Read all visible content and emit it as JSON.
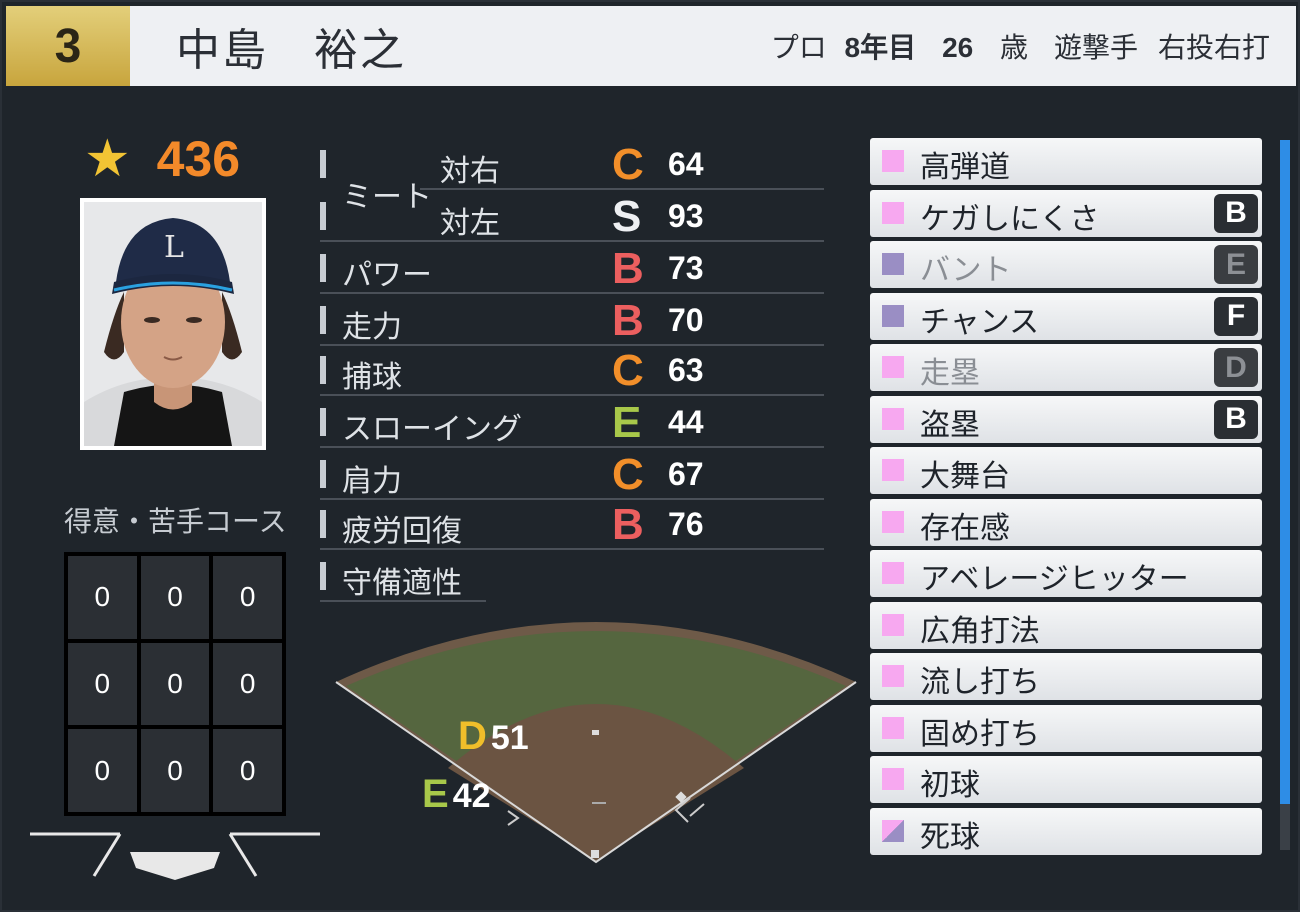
{
  "player": {
    "number": "3",
    "name": "中島　裕之",
    "pro_label": "プロ",
    "years": "8年目",
    "age": "26",
    "age_unit": "歳",
    "position": "遊撃手",
    "handedness": "右投右打",
    "star_icon": "star-icon",
    "power_rating": "436"
  },
  "course": {
    "label": "得意・苦手コース",
    "cells": [
      "0",
      "0",
      "0",
      "0",
      "0",
      "0",
      "0",
      "0",
      "0"
    ]
  },
  "stats": [
    {
      "label": "ミート",
      "sub": "対右",
      "grade": "C",
      "value": "64"
    },
    {
      "label": "",
      "sub": "対左",
      "grade": "S",
      "value": "93"
    },
    {
      "label": "パワー",
      "grade": "B",
      "value": "73"
    },
    {
      "label": "走力",
      "grade": "B",
      "value": "70"
    },
    {
      "label": "捕球",
      "grade": "C",
      "value": "63"
    },
    {
      "label": "スローイング",
      "grade": "E",
      "value": "44"
    },
    {
      "label": "肩力",
      "grade": "C",
      "value": "67"
    },
    {
      "label": "疲労回復",
      "grade": "B",
      "value": "76"
    },
    {
      "label": "守備適性"
    }
  ],
  "fielding": [
    {
      "grade": "D",
      "value": "51"
    },
    {
      "grade": "E",
      "value": "42"
    }
  ],
  "abilities": [
    {
      "label": "高弾道",
      "color": "#f7a8f0",
      "badge": "",
      "dim": false
    },
    {
      "label": "ケガしにくさ",
      "color": "#f7a8f0",
      "badge": "B",
      "dim": false
    },
    {
      "label": "バント",
      "color": "#9a8ec4",
      "badge": "E",
      "dim": true
    },
    {
      "label": "チャンス",
      "color": "#9a8ec4",
      "badge": "F",
      "dim": false
    },
    {
      "label": "走塁",
      "color": "#f7a8f0",
      "badge": "D",
      "dim": true
    },
    {
      "label": "盗塁",
      "color": "#f7a8f0",
      "badge": "B",
      "dim": false
    },
    {
      "label": "大舞台",
      "color": "#f7a8f0",
      "badge": "",
      "dim": false
    },
    {
      "label": "存在感",
      "color": "#f7a8f0",
      "badge": "",
      "dim": false
    },
    {
      "label": "アベレージヒッター",
      "color": "#f7a8f0",
      "badge": "",
      "dim": false
    },
    {
      "label": "広角打法",
      "color": "#f7a8f0",
      "badge": "",
      "dim": false
    },
    {
      "label": "流し打ち",
      "color": "#f7a8f0",
      "badge": "",
      "dim": false
    },
    {
      "label": "固め打ち",
      "color": "#f7a8f0",
      "badge": "",
      "dim": false
    },
    {
      "label": "初球",
      "color": "#f7a8f0",
      "badge": "",
      "dim": false
    },
    {
      "label": "死球",
      "color": "#f7a8f0",
      "badge": "",
      "dim": false,
      "half": "#9a8ec4"
    }
  ]
}
